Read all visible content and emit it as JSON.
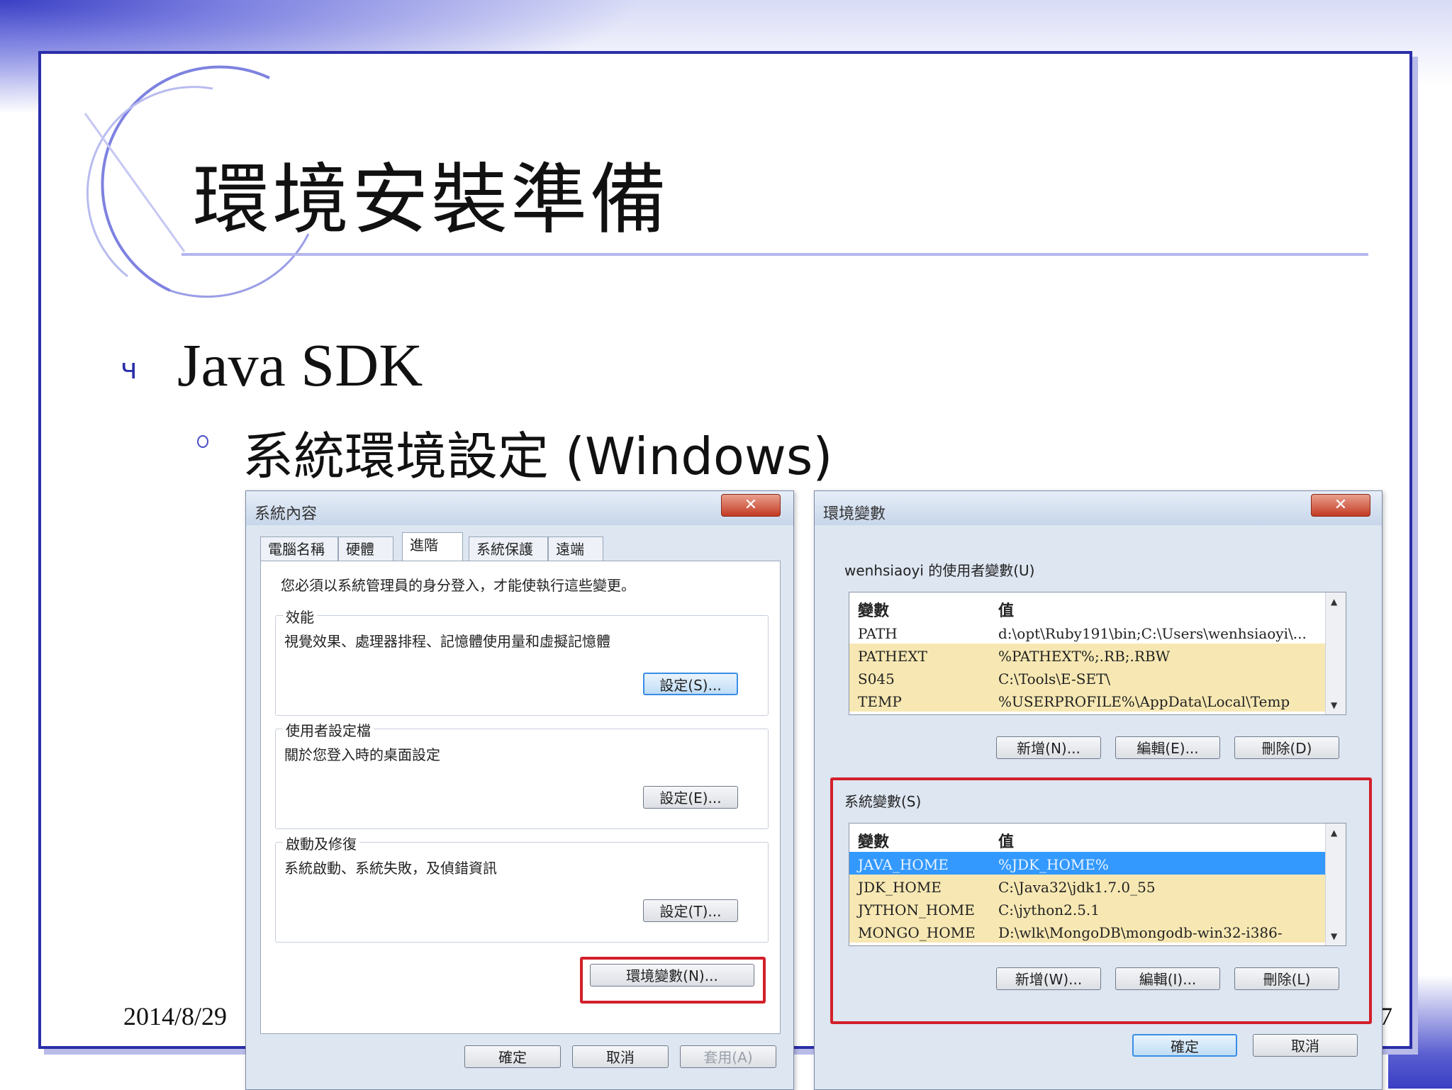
{
  "slide": {
    "title": "環境安裝準備",
    "level1": "Java SDK",
    "level2": "系統環境設定 (Windows)",
    "footer_date": "2014/8/29",
    "page_number": "7",
    "level1_bullet": "ч"
  },
  "sysprops": {
    "title": "系統內容",
    "close": "✕",
    "tabs": [
      "電腦名稱",
      "硬體",
      "進階",
      "系統保護",
      "遠端"
    ],
    "admin_note": "您必須以系統管理員的身分登入，才能使執行這些變更。",
    "perf_label": "效能",
    "perf_desc": "視覺效果、處理器排程、記憶體使用量和虛擬記憶體",
    "perf_btn": "設定(S)...",
    "profile_label": "使用者設定檔",
    "profile_desc": "關於您登入時的桌面設定",
    "profile_btn": "設定(E)...",
    "startup_label": "啟動及修復",
    "startup_desc": "系統啟動、系統失敗，及偵錯資訊",
    "startup_btn": "設定(T)...",
    "env_btn": "環境變數(N)...",
    "ok": "確定",
    "cancel": "取消",
    "apply": "套用(A)"
  },
  "envvars": {
    "title": "環境變數",
    "close": "✕",
    "user_label": "wenhsiaoyi 的使用者變數(U)",
    "col_var": "變數",
    "col_val": "值",
    "user_rows": [
      {
        "name": "PATH",
        "value": "d:\\opt\\Ruby191\\bin;C:\\Users\\wenhsiaoyi\\..."
      },
      {
        "name": "PATHEXT",
        "value": "%PATHEXT%;.RB;.RBW"
      },
      {
        "name": "S045",
        "value": "C:\\Tools\\E-SET\\"
      },
      {
        "name": "TEMP",
        "value": "%USERPROFILE%\\AppData\\Local\\Temp"
      }
    ],
    "user_new": "新增(N)...",
    "user_edit": "編輯(E)...",
    "user_delete": "刪除(D)",
    "sys_label": "系統變數(S)",
    "sys_rows": [
      {
        "name": "JAVA_HOME",
        "value": "%JDK_HOME%"
      },
      {
        "name": "JDK_HOME",
        "value": "C:\\Java32\\jdk1.7.0_55"
      },
      {
        "name": "JYTHON_HOME",
        "value": "C:\\jython2.5.1"
      },
      {
        "name": "MONGO_HOME",
        "value": "D:\\wlk\\MongoDB\\mongodb-win32-i386-"
      }
    ],
    "sys_new": "新增(W)...",
    "sys_edit": "編輯(I)...",
    "sys_delete": "刪除(L)",
    "ok": "確定",
    "cancel": "取消"
  },
  "colors": {
    "accent": "#2a2ea8",
    "highlight_box": "#d2202a",
    "selected_row": "#3399ff",
    "yellow_row": "#f7e8b3"
  }
}
